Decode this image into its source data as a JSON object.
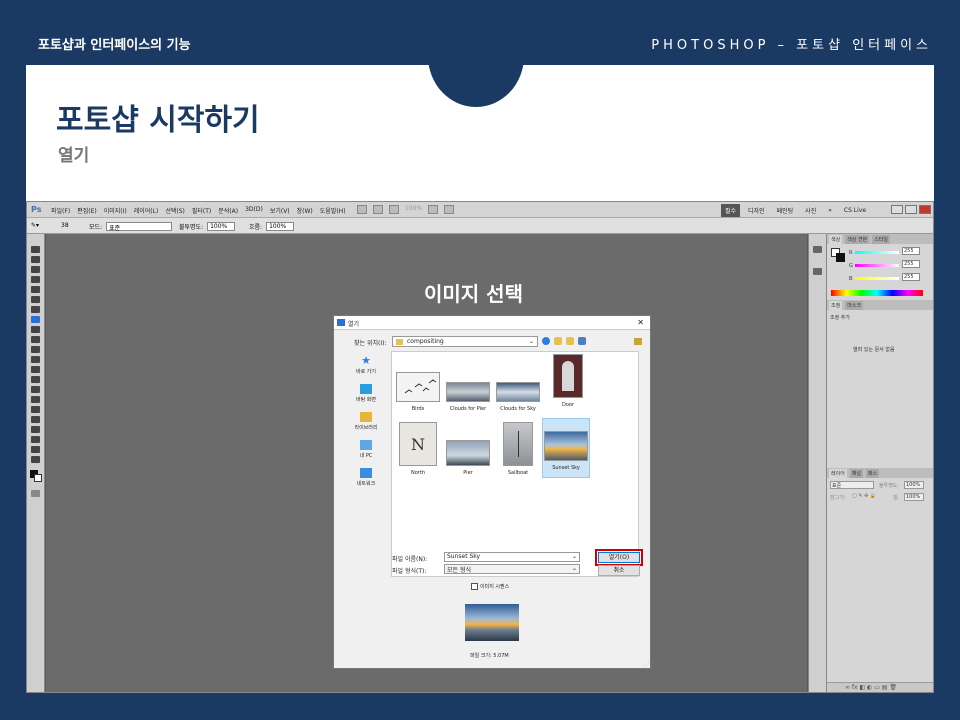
{
  "slide": {
    "header_left": "포토샵과 인터페이스의 기능",
    "header_right": "PHOTOSHOP – 포토샵 인터페이스",
    "title": "포토샵 시작하기",
    "subtitle": "열기",
    "overlay_title": "이미지 선택"
  },
  "photoshop": {
    "logo": "Ps",
    "menus": [
      "파일(F)",
      "편집(E)",
      "이미지(I)",
      "레이어(L)",
      "선택(S)",
      "필터(T)",
      "분석(A)",
      "3D(D)",
      "보기(V)",
      "창(W)",
      "도움말(H)"
    ],
    "zoom": "100%",
    "workspaces": [
      "필수",
      "디자인",
      "페인팅",
      "사진"
    ],
    "cs_live": "CS Live",
    "options_bar": {
      "mode_label": "모드:",
      "mode_value": "표준",
      "opacity_label": "불투명도:",
      "opacity_value": "100%",
      "flow_label": "흐름:",
      "flow_value": "100%",
      "brush_size": "38"
    },
    "panels": {
      "color_tabs": [
        "색상",
        "색상 견본",
        "스타일"
      ],
      "color_values": [
        "255",
        "255",
        "255"
      ],
      "channels": [
        "R",
        "G",
        "B"
      ],
      "adjust_tabs": [
        "조정",
        "마스크"
      ],
      "adjust_title": "조정 추가",
      "adjust_message": "열려 있는 문서 없음",
      "layers_tabs": [
        "레이어",
        "채널",
        "패스"
      ],
      "layers_mode": "표준",
      "opacity_label": "불투명도:",
      "opacity": "100%",
      "lock_label": "잠그기:",
      "fill_label": "칠:",
      "fill": "100%"
    }
  },
  "dialog": {
    "title": "열기",
    "look_in_label": "찾는 위치(I):",
    "look_in_value": "compositing",
    "places": [
      "바로 가기",
      "바탕 화면",
      "라이브러리",
      "내 PC",
      "네트워크"
    ],
    "files": [
      "Birds",
      "Clouds for Pier",
      "Clouds for Sky",
      "Door",
      "North",
      "Pier",
      "Sailboat",
      "Sunset Sky"
    ],
    "filename_label": "파일 이름(N):",
    "filename_value": "Sunset Sky",
    "filetype_label": "파일 형식(T):",
    "filetype_value": "모든 형식",
    "open_button": "열기(O)",
    "cancel_button": "취소",
    "sequence_label": "이미지 시퀀스",
    "file_size": "파일 크기: 5.07M"
  }
}
